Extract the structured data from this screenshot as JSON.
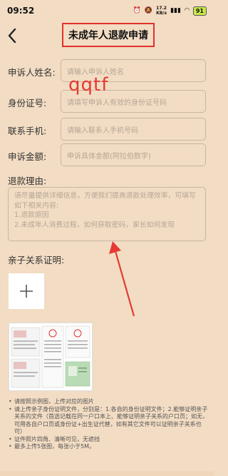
{
  "status_bar": {
    "time": "09:52",
    "net_speed": "17.2",
    "net_unit": "KB/s",
    "signal": "4G",
    "battery": "91"
  },
  "header": {
    "back_icon": "chevron-left-icon",
    "title": "未成年人退款申请"
  },
  "form": {
    "name": {
      "label": "申诉人姓名:",
      "placeholder": "请输入申诉人姓名"
    },
    "id_card": {
      "label": "身份证号:",
      "placeholder": "请填写申诉人有效的身份证号码"
    },
    "phone": {
      "label": "联系手机:",
      "placeholder": "请输入联系人手机号码"
    },
    "amount": {
      "label": "申诉金额:",
      "placeholder": "申诉具体金额(阿拉伯数字)"
    }
  },
  "overlay_text": "qqtf",
  "reason": {
    "label": "退款理由:",
    "placeholder": "请尽量提供详细信息，方便我们提高退款处理效率，可填写如下相关内容:\n1.退款原因\n2.未成年人消费过程，如何获取密码，家长如何发现"
  },
  "proof": {
    "label": "亲子关系证明:",
    "upload_icon": "plus-icon"
  },
  "notes": [
    "请按照示例图，上传对应的图片",
    "请上传亲子身份证明文件，分别是：1.各自的身份证明文件；2.能够证明亲子关系的文件（首选记载在同一户口本上、能够证明亲子关系的户口页；如无，可用各自户口页或身份证+出生证代替，如有其它文件可以证明亲子关系也可）",
    "证件照片四角、清晰可见，无遮挡",
    "最多上传5张图，每张小于5M。"
  ],
  "colors": {
    "background": "#f2dcc3",
    "highlight_red": "#e2322b",
    "placeholder": "#b5a696"
  }
}
